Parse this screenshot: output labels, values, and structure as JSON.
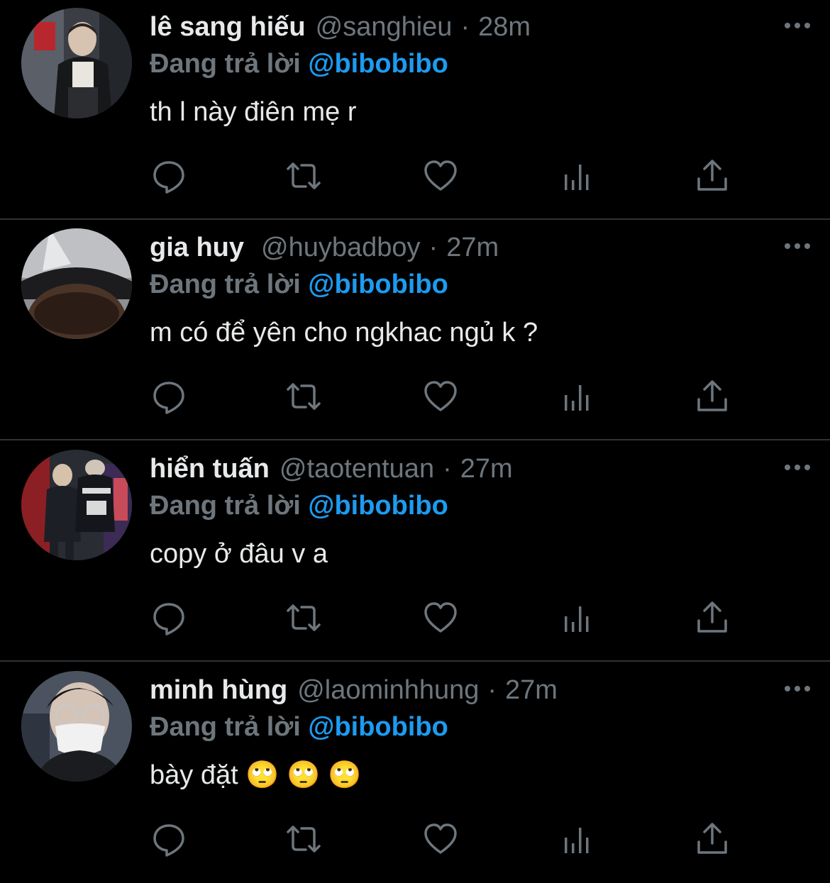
{
  "colors": {
    "background": "#000000",
    "primary_text": "#e7e9ea",
    "secondary_text": "#6e767d",
    "mention": "#1d9bf0",
    "divider": "#2f3336"
  },
  "icons": {
    "more": "more-horizontal-icon",
    "reply": "reply-bubble-icon",
    "retweet": "retweet-icon",
    "like": "heart-icon",
    "views": "bar-chart-icon",
    "share": "share-upload-icon"
  },
  "replies": [
    {
      "display_name": "lê sang hiếu",
      "handle": "@sanghieu",
      "dot": "·",
      "time": "28m",
      "replying_prefix": "Đang trả lời",
      "replying_to": "@bibobibo",
      "text": "th l này điên mẹ r"
    },
    {
      "display_name": "gia huy",
      "handle": "@huybadboy",
      "dot": "·",
      "time": "27m",
      "replying_prefix": "Đang trả lời",
      "replying_to": "@bibobibo",
      "text": "m có để yên cho ngkhac ngủ k ?"
    },
    {
      "display_name": "hiển tuấn",
      "handle": "@taotentuan",
      "dot": "·",
      "time": "27m",
      "replying_prefix": "Đang trả lời",
      "replying_to": "@bibobibo",
      "text": "copy ở đâu v a"
    },
    {
      "display_name": "minh hùng",
      "handle": "@laominhhung",
      "dot": "·",
      "time": "27m",
      "replying_prefix": "Đang trả lời",
      "replying_to": "@bibobibo",
      "text": "bày đặt 🙄 🙄 🙄"
    }
  ]
}
